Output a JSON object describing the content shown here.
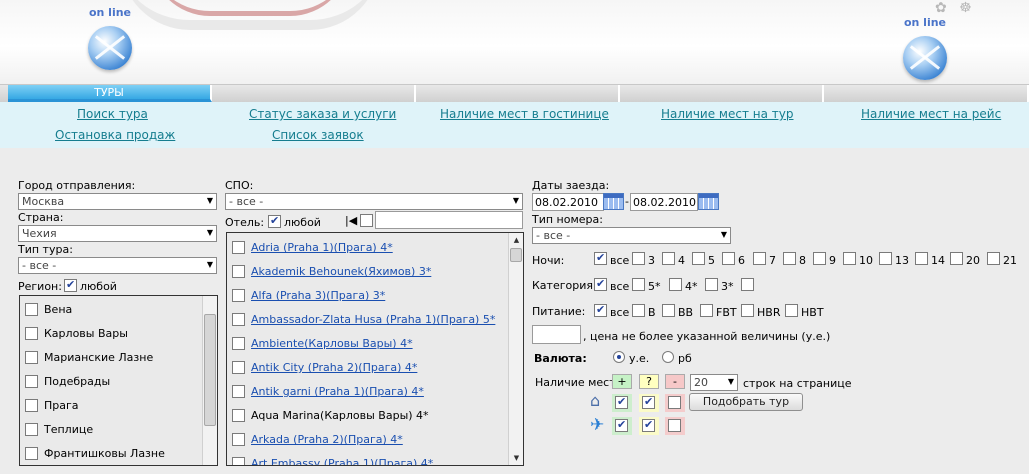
{
  "header": {
    "logo_text": "on line",
    "deco_icons": "✿ ☸"
  },
  "tabs": [
    {
      "label": "ТУРЫ",
      "active": true
    },
    {
      "label": "",
      "active": false
    },
    {
      "label": "",
      "active": false
    },
    {
      "label": "",
      "active": false
    },
    {
      "label": "",
      "active": false
    }
  ],
  "menu": {
    "search": "Поиск тура",
    "order_status": "Статус заказа и услуги",
    "hotel_availability": "Наличие мест в гостинице",
    "tour_availability": "Наличие мест на тур",
    "flight_availability": "Наличие мест на рейс",
    "stop_sale": "Остановка продаж",
    "requests": "Список заявок"
  },
  "form": {
    "departure_city": {
      "label": "Город отправления:",
      "value": "Москва"
    },
    "country": {
      "label": "Страна:",
      "value": "Чехия"
    },
    "tour_type": {
      "label": "Тип тура:",
      "value": "- все -"
    },
    "region": {
      "label": "Регион:",
      "any_label": "любой",
      "any_checked": true,
      "items": [
        "Вена",
        "Карловы Вары",
        "Марианские Лазне",
        "Подебрады",
        "Прага",
        "Теплице",
        "Франтишковы Лазне"
      ]
    },
    "spo": {
      "label": "СПО:",
      "value": "- все -"
    },
    "hotel": {
      "label": "Отель:",
      "any_label": "любой",
      "any_checked": true,
      "filter_value": "",
      "items": [
        {
          "name": "Adria (Praha 1)(Прага) 4*",
          "link": true
        },
        {
          "name": "Akademik Behounek(Яхимов) 3*",
          "link": true
        },
        {
          "name": "Alfa (Praha 3)(Прага) 3*",
          "link": true
        },
        {
          "name": "Ambassador-Zlata Husa (Praha 1)(Прага) 5*",
          "link": true
        },
        {
          "name": "Ambiente(Карловы Вары) 4*",
          "link": true
        },
        {
          "name": "Antik City (Praha 2)(Прага) 4*",
          "link": true
        },
        {
          "name": "Antik garni (Praha 1)(Прага) 4*",
          "link": true
        },
        {
          "name": "Aqua Marina(Карловы Вары) 4*",
          "link": false
        },
        {
          "name": "Arkada (Praha 2)(Прага) 4*",
          "link": true
        },
        {
          "name": "Art Embassy (Praha 1)(Прага) 4*",
          "link": true
        }
      ]
    },
    "dates": {
      "label": "Даты заезда:",
      "from": "08.02.2010",
      "separator": "-",
      "to": "08.02.2010"
    },
    "room_type": {
      "label": "Тип номера:",
      "value": "- все -"
    },
    "nights": {
      "label": "Ночи:",
      "options": [
        {
          "label": "все",
          "checked": true
        },
        {
          "label": "3"
        },
        {
          "label": "4"
        },
        {
          "label": "5"
        },
        {
          "label": "6"
        },
        {
          "label": "7"
        },
        {
          "label": "8"
        },
        {
          "label": "9"
        },
        {
          "label": "10"
        },
        {
          "label": "13"
        },
        {
          "label": "14"
        },
        {
          "label": "20"
        },
        {
          "label": "21"
        }
      ]
    },
    "category": {
      "label": "Категория:",
      "options": [
        {
          "label": "все",
          "checked": true
        },
        {
          "label": "5*"
        },
        {
          "label": "4*"
        },
        {
          "label": "3*"
        },
        {
          "label": ""
        }
      ]
    },
    "meals": {
      "label": "Питание:",
      "options": [
        {
          "label": "все",
          "checked": true
        },
        {
          "label": "B"
        },
        {
          "label": "BB"
        },
        {
          "label": "FBT"
        },
        {
          "label": "HBR"
        },
        {
          "label": "HBT"
        }
      ]
    },
    "price": {
      "value": "",
      "note": ", цена не более указанной величины (у.е.)"
    },
    "currency": {
      "label": "Валюта:",
      "options": [
        {
          "label": "у.е.",
          "checked": true
        },
        {
          "label": "рб",
          "checked": false
        }
      ]
    },
    "availability": {
      "label": "Наличие мест:",
      "plus": "+",
      "question": "?",
      "minus": "-",
      "per_page_value": "20",
      "per_page_label": "строк на странице",
      "hotel_row": [
        true,
        true,
        false
      ],
      "flight_row": [
        true,
        true,
        false
      ]
    },
    "submit_label": "Подобрать тур"
  },
  "colors": {
    "accent_tab": "#36a8e4",
    "menu_bg": "#dff3f9",
    "link": "#157d8f",
    "hotel_link": "#1a4fb0"
  }
}
